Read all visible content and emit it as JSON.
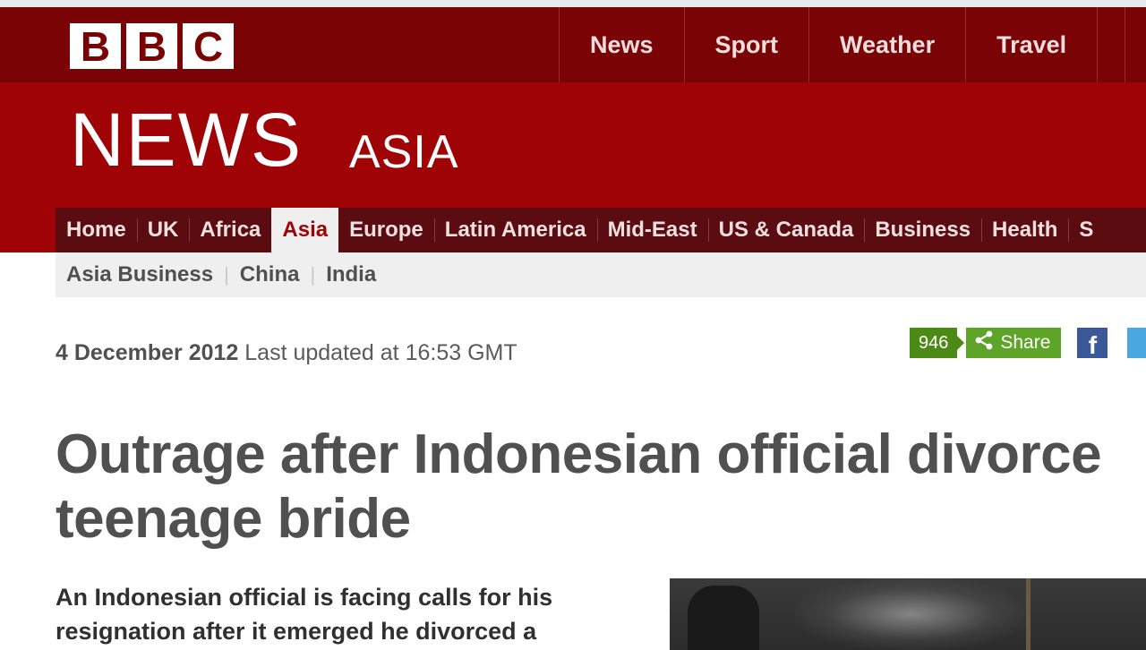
{
  "masthead": {
    "logo": [
      "B",
      "B",
      "C"
    ],
    "global_nav": [
      "News",
      "Sport",
      "Weather",
      "Travel"
    ]
  },
  "banner": {
    "title": "NEWS",
    "section": "ASIA"
  },
  "section_nav": {
    "items": [
      "Home",
      "UK",
      "Africa",
      "Asia",
      "Europe",
      "Latin America",
      "Mid-East",
      "US & Canada",
      "Business",
      "Health",
      "S"
    ],
    "active": "Asia"
  },
  "sub_nav": {
    "items": [
      "Asia Business",
      "China",
      "India"
    ],
    "separator": "|"
  },
  "article": {
    "date": "4 December 2012",
    "updated": "Last updated at 16:53 GMT",
    "headline_line1": "Outrage after Indonesian official divorce",
    "headline_line2": "teenage bride",
    "summary_line1": "An Indonesian official is facing calls for his",
    "summary_line2": "resignation after it emerged he divorced a"
  },
  "share": {
    "count": "946",
    "label": "Share",
    "facebook_glyph": "f",
    "icons": [
      "share-icon",
      "facebook-icon",
      "twitter-icon"
    ]
  },
  "colors": {
    "masthead": "#7a0306",
    "banner": "#a00306",
    "section_nav": "#5a0c10",
    "share_green": "#5ea428",
    "facebook_blue": "#3b5998"
  }
}
